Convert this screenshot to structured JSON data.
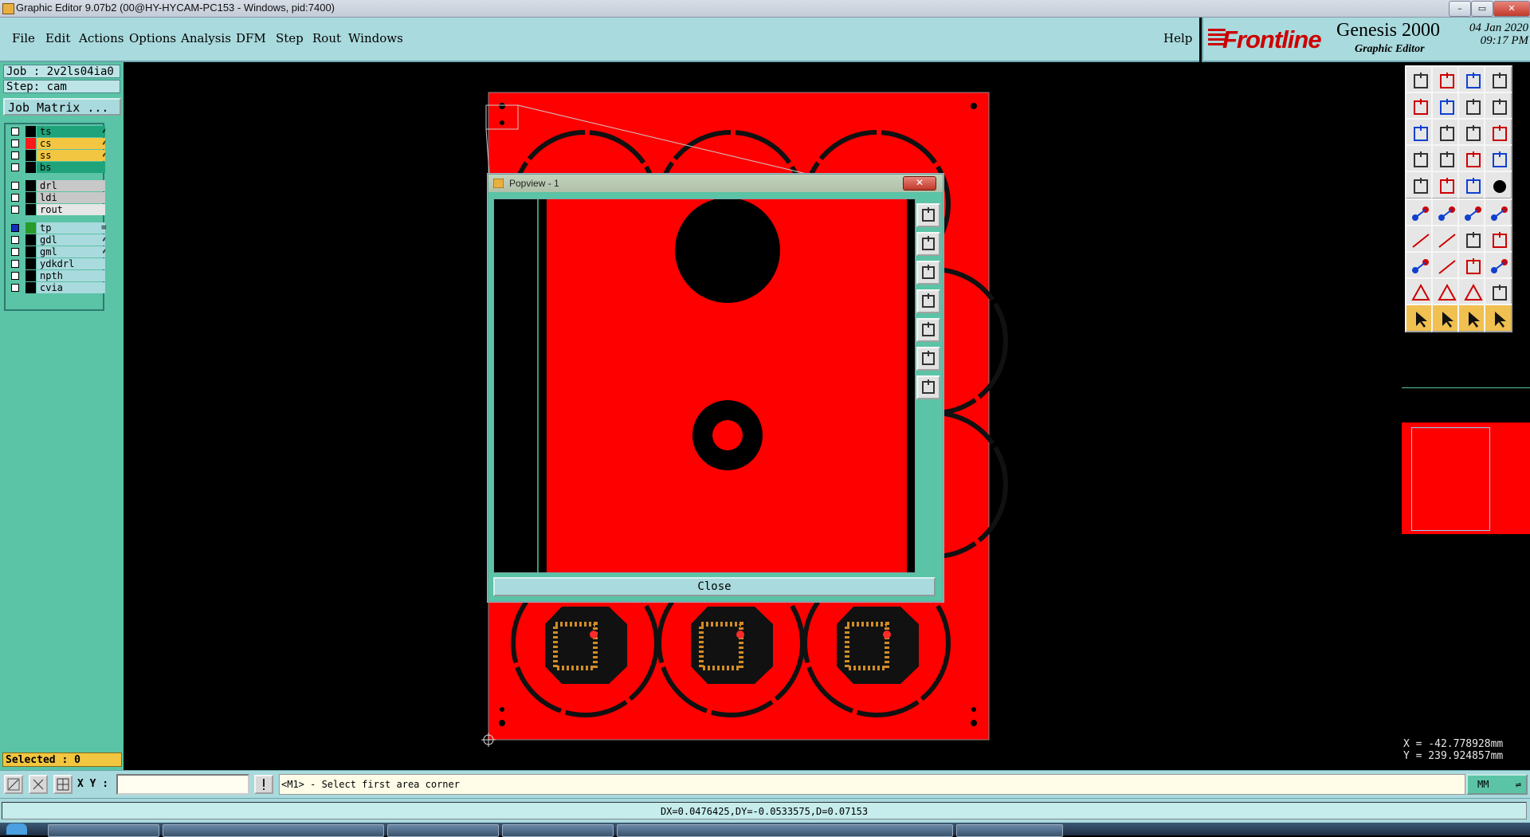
{
  "window": {
    "title": "Graphic Editor 9.07b2 (00@HY-HYCAM-PC153 - Windows, pid:7400)",
    "controls": [
      "–",
      "▭",
      "✕"
    ]
  },
  "menu": {
    "items": [
      {
        "label": "File"
      },
      {
        "label": "Edit"
      },
      {
        "label": "Actions"
      },
      {
        "label": "Options"
      },
      {
        "label": "Analysis"
      },
      {
        "label": "DFM"
      },
      {
        "label": "Step"
      },
      {
        "label": "Rout"
      },
      {
        "label": "Windows"
      }
    ],
    "help": "Help"
  },
  "brand": {
    "logo": "Frontline",
    "product": "Genesis 2000",
    "subtitle": "Graphic Editor",
    "date": "04 Jan 2020",
    "time": "09:17 PM"
  },
  "left_panel": {
    "job": "Job : 2v2ls04ia0",
    "step": "Step: cam",
    "job_matrix": "Job Matrix ...",
    "layers": [
      {
        "name": "ts",
        "color": "#1fa37a",
        "swatch": "#000000",
        "mark": "⸙"
      },
      {
        "name": "cs",
        "color": "#f2c640",
        "swatch": "#ff1a1a",
        "mark": "⸙"
      },
      {
        "name": "ss",
        "color": "#f2c640",
        "swatch": "#000000",
        "mark": "⸙"
      },
      {
        "name": "bs",
        "color": "#1fa37a",
        "swatch": "#000000",
        "mark": ""
      },
      {
        "name": "drl",
        "color": "#c8c8c8",
        "swatch": "#000000",
        "mark": ""
      },
      {
        "name": "ldi",
        "color": "#c8c8c8",
        "swatch": "#000000",
        "mark": ""
      },
      {
        "name": "rout",
        "color": "#e6e6e6",
        "swatch": "#000000",
        "mark": ""
      },
      {
        "name": "tp",
        "color": "#a9dadd",
        "swatch": "#2a9a2a",
        "mark": "≡"
      },
      {
        "name": "gdl",
        "color": "#a9dadd",
        "swatch": "#000000",
        "mark": "⸙"
      },
      {
        "name": "gml",
        "color": "#a9dadd",
        "swatch": "#000000",
        "mark": "⸙"
      },
      {
        "name": "ydkdrl",
        "color": "#a9dadd",
        "swatch": "#000000",
        "mark": ""
      },
      {
        "name": "npth",
        "color": "#a9dadd",
        "swatch": "#000000",
        "mark": ""
      },
      {
        "name": "cvia",
        "color": "#a9dadd",
        "swatch": "#000000",
        "mark": ""
      }
    ],
    "selected": "Selected : 0"
  },
  "popview": {
    "title": "Popview - 1",
    "close_label": "Close",
    "close_x": "✕",
    "toolbar": [
      "pv-zoom-home-icon",
      "pv-pan-up-icon",
      "pv-pan-down-icon",
      "pv-pan-left-icon",
      "pv-pan-right-icon",
      "pv-zoom-in-icon",
      "pv-zoom-out-icon"
    ]
  },
  "right_toolbar": {
    "buttons": [
      "pan-up-icon",
      "pan-down-icon",
      "home-icon",
      "window-split-icon",
      "pan-left-icon",
      "pan-right-icon",
      "undo-icon",
      "redo-icon",
      "zoom-fit-icon",
      "zoom-center-icon",
      "scale-1to2-icon",
      "help-icon",
      "grid-snap-icon",
      "grid-icon",
      "layer-toggle-icon",
      "layer-toggle-2-icon",
      "camera-icon",
      "red-square-icon",
      "ruler-icon",
      "black-dot-icon",
      "nodes-blue-icon",
      "cross-nodes-icon",
      "line-node-icon",
      "slash-node-icon",
      "red-line-icon",
      "pen-line-icon",
      "rotate-icon",
      "mirror-icon",
      "node-square-icon",
      "red-dash-icon",
      "measure-icon",
      "blue-circles-icon",
      "triangle-red-icon",
      "triangle-outline-icon",
      "trapezoid-icon",
      "arc-icon",
      "select-arrow-icon",
      "select-arrow-2-icon",
      "select-arrow-3-icon",
      "select-route-icon"
    ],
    "orange_row": 9
  },
  "coords": {
    "x": "X = -42.778928mm",
    "y": "Y = 239.924857mm"
  },
  "command_bar": {
    "xy_label": "X Y :",
    "xy_value": "",
    "prompt": "<M1> - Select first area corner",
    "unit": "MM"
  },
  "status": {
    "message": "DX=0.0476425,DY=-0.0533575,D=0.07153"
  }
}
